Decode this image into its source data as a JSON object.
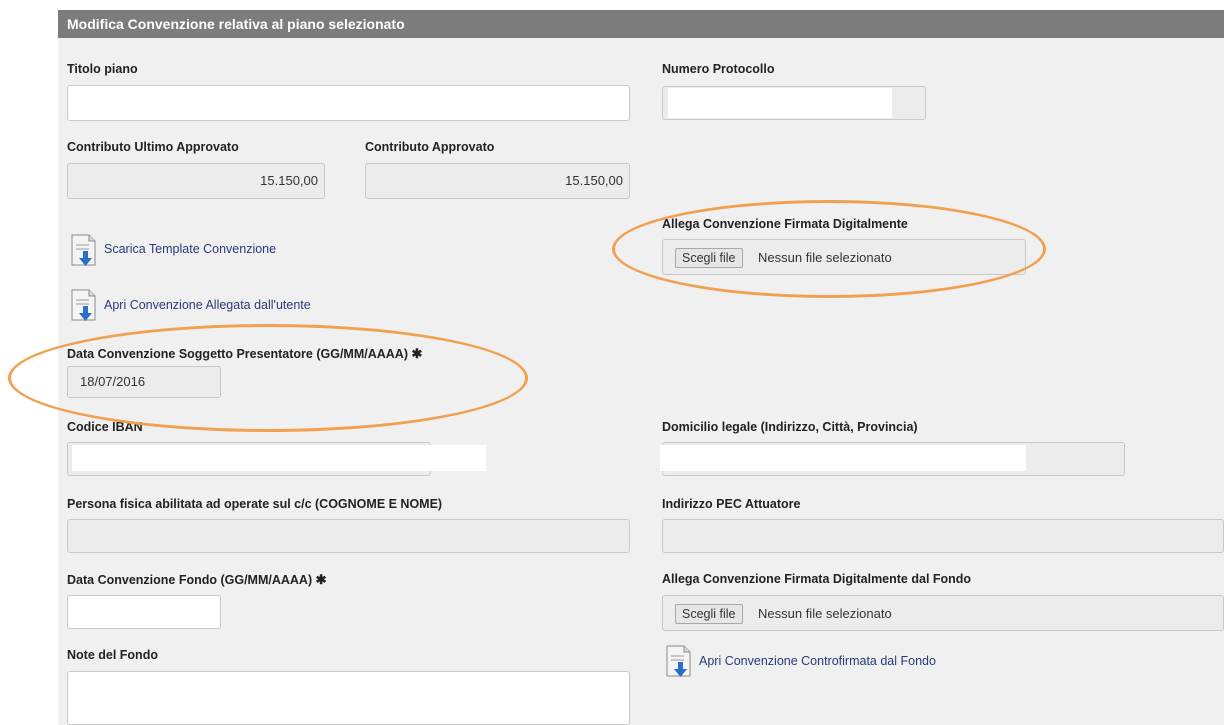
{
  "header": {
    "title": "Modifica Convenzione relativa al piano selezionato"
  },
  "fields": {
    "titolo_piano": {
      "label": "Titolo piano",
      "value": ""
    },
    "numero_protocollo": {
      "label": "Numero Protocollo",
      "value": ""
    },
    "contributo_ultimo": {
      "label": "Contributo Ultimo Approvato",
      "value": "15.150,00"
    },
    "contributo_approvato": {
      "label": "Contributo Approvato",
      "value": "15.150,00"
    },
    "allega_convenzione": {
      "label": "Allega Convenzione Firmata Digitalmente",
      "button": "Scegli file",
      "status": "Nessun file selezionato"
    },
    "data_convenzione_soggetto": {
      "label": "Data Convenzione Soggetto Presentatore (GG/MM/AAAA)",
      "required_mark": "✱",
      "value": "18/07/2016"
    },
    "codice_iban": {
      "label": "Codice IBAN",
      "value": ""
    },
    "domicilio_legale": {
      "label": "Domicilio legale (Indirizzo, Città, Provincia)",
      "value": ""
    },
    "persona_fisica": {
      "label": "Persona fisica abilitata ad operate sul c/c (COGNOME E NOME)",
      "value": ""
    },
    "indirizzo_pec": {
      "label": "Indirizzo PEC Attuatore",
      "value": ""
    },
    "data_convenzione_fondo": {
      "label": "Data Convenzione Fondo (GG/MM/AAAA)",
      "required_mark": "✱",
      "value": ""
    },
    "allega_fondo": {
      "label": "Allega Convenzione Firmata Digitalmente dal Fondo",
      "button": "Scegli file",
      "status": "Nessun file selezionato"
    },
    "note_fondo": {
      "label": "Note del Fondo",
      "value": ""
    }
  },
  "links": {
    "scarica_template": {
      "label": "Scarica Template Convenzione",
      "icon": "document-download-icon"
    },
    "apri_allegata": {
      "label": "Apri Convenzione Allegata dall'utente",
      "icon": "document-download-icon"
    },
    "apri_controfirmata": {
      "label": "Apri Convenzione Controfirmata dal Fondo",
      "icon": "document-download-icon"
    }
  },
  "colors": {
    "header_bg": "#7c7c7c",
    "panel_bg": "#f0f0f0",
    "annotation": "#f0a050",
    "link": "#2a3a7a"
  }
}
